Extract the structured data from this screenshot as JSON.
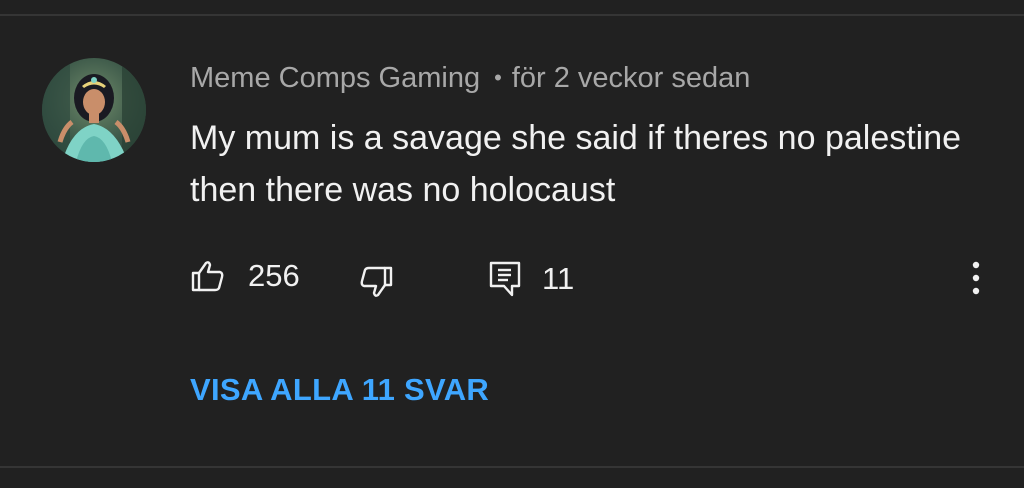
{
  "comment": {
    "author": "Meme Comps Gaming",
    "separator": "•",
    "time": "för 2 veckor sedan",
    "text": "My mum is a savage she said if theres no palestine then there was no holocaust",
    "like_count": "256",
    "reply_count": "11"
  },
  "replies_link": "VISA ALLA 11 SVAR",
  "icons": {
    "like": "thumb-up-icon",
    "dislike": "thumb-down-icon",
    "reply": "comment-icon",
    "more": "more-vertical-icon"
  },
  "colors": {
    "background": "#212121",
    "text_primary": "#f1f1f1",
    "text_secondary": "#a8a8a8",
    "link": "#3ea6ff"
  }
}
